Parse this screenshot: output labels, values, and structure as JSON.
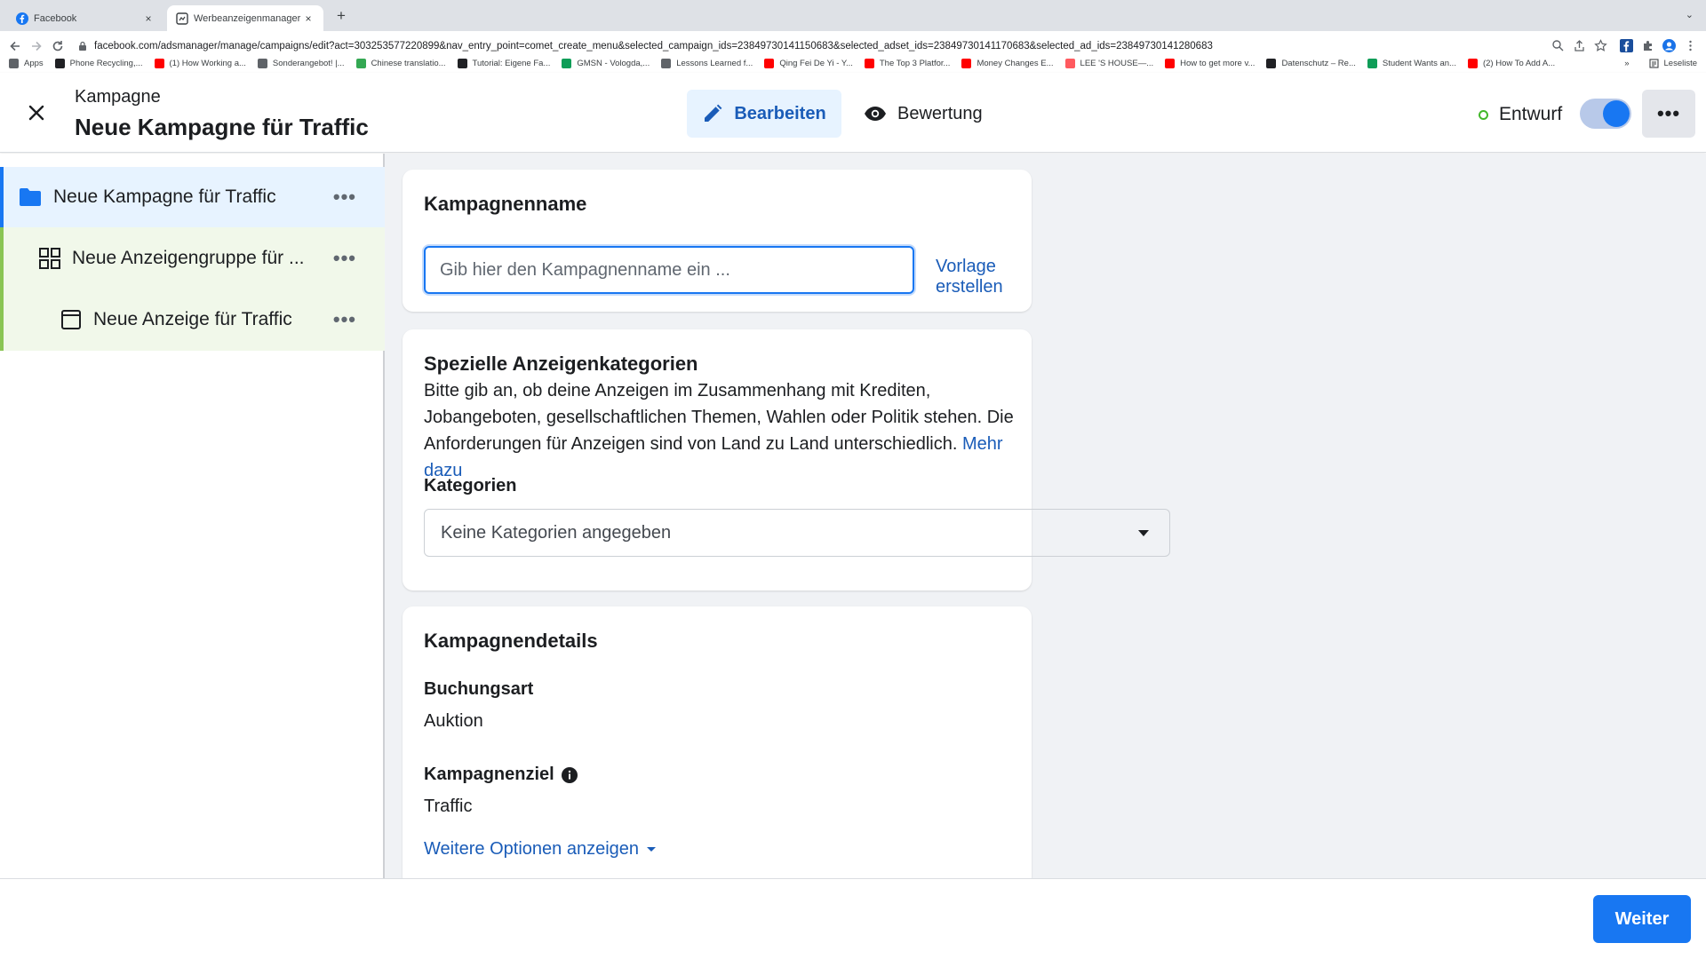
{
  "browser": {
    "tabs": [
      {
        "title": "Facebook",
        "favicon": "facebook-icon",
        "close": "×"
      },
      {
        "title": "Werbeanzeigenmanager - Wer",
        "favicon": "ads-manager-icon",
        "close": "×"
      }
    ],
    "new_tab": "+",
    "tab_menu": "⌄",
    "url": "facebook.com/adsmanager/manage/campaigns/edit?act=303253577220899&nav_entry_point=comet_create_menu&selected_campaign_ids=23849730141150683&selected_adset_ids=23849730141170683&selected_ad_ids=23849730141280683",
    "bookmarks": [
      {
        "label": "Apps",
        "color": "#5f6368"
      },
      {
        "label": "Phone Recycling,...",
        "color": "#202124"
      },
      {
        "label": "(1) How Working a...",
        "color": "#ff0000"
      },
      {
        "label": "Sonderangebot! |...",
        "color": "#5f6368"
      },
      {
        "label": "Chinese translatio...",
        "color": "#34a853"
      },
      {
        "label": "Tutorial: Eigene Fa...",
        "color": "#202124"
      },
      {
        "label": "GMSN - Vologda,...",
        "color": "#0f9d58"
      },
      {
        "label": "Lessons Learned f...",
        "color": "#5f6368"
      },
      {
        "label": "Qing Fei De Yi - Y...",
        "color": "#ff0000"
      },
      {
        "label": "The Top 3 Platfor...",
        "color": "#ff0000"
      },
      {
        "label": "Money Changes E...",
        "color": "#ff0000"
      },
      {
        "label": "LEE 'S HOUSE—...",
        "color": "#ff5a5f"
      },
      {
        "label": "How to get more v...",
        "color": "#ff0000"
      },
      {
        "label": "Datenschutz – Re...",
        "color": "#202124"
      },
      {
        "label": "Student Wants an...",
        "color": "#0f9d58"
      },
      {
        "label": "(2) How To Add A...",
        "color": "#ff0000"
      }
    ],
    "bookmarks_overflow": "»",
    "reading_list": "Leseliste"
  },
  "header": {
    "label": "Kampagne",
    "title": "Neue Kampagne für Traffic",
    "edit_button": "Bearbeiten",
    "review_button": "Bewertung",
    "status": "Entwurf",
    "more": "•••"
  },
  "sidebar": {
    "items": [
      {
        "label": "Neue Kampagne für Traffic",
        "more": "•••",
        "icon": "folder-icon"
      },
      {
        "label": "Neue Anzeigengruppe für ...",
        "more": "•••",
        "icon": "grid-icon"
      },
      {
        "label": "Neue Anzeige für Traffic",
        "more": "•••",
        "icon": "ad-icon"
      }
    ]
  },
  "campaign_name": {
    "heading": "Kampagnenname",
    "placeholder": "Gib hier den Kampagnenname ein ...",
    "template_link": "Vorlage erstellen"
  },
  "special_categories": {
    "heading": "Spezielle Anzeigenkategorien",
    "description": "Bitte gib an, ob deine Anzeigen im Zusammenhang mit Krediten, Jobangeboten, gesellschaftlichen Themen, Wahlen oder Politik stehen. Die Anforderungen für Anzeigen sind von Land zu Land unterschiedlich.",
    "more_link": "Mehr dazu",
    "categories_label": "Kategorien",
    "categories_value": "Keine Kategorien angegeben"
  },
  "campaign_details": {
    "heading": "Kampagnendetails",
    "booking_label": "Buchungsart",
    "booking_value": "Auktion",
    "objective_label": "Kampagnenziel",
    "objective_value": "Traffic",
    "more_options": "Weitere Optionen anzeigen"
  },
  "footer": {
    "next_button": "Weiter"
  },
  "colors": {
    "accent": "#1877f2",
    "link": "#1a5cb8",
    "status_draft": "#42b72a",
    "selected_bg": "#e7f3ff",
    "adset_bg": "#f1f8ea"
  }
}
